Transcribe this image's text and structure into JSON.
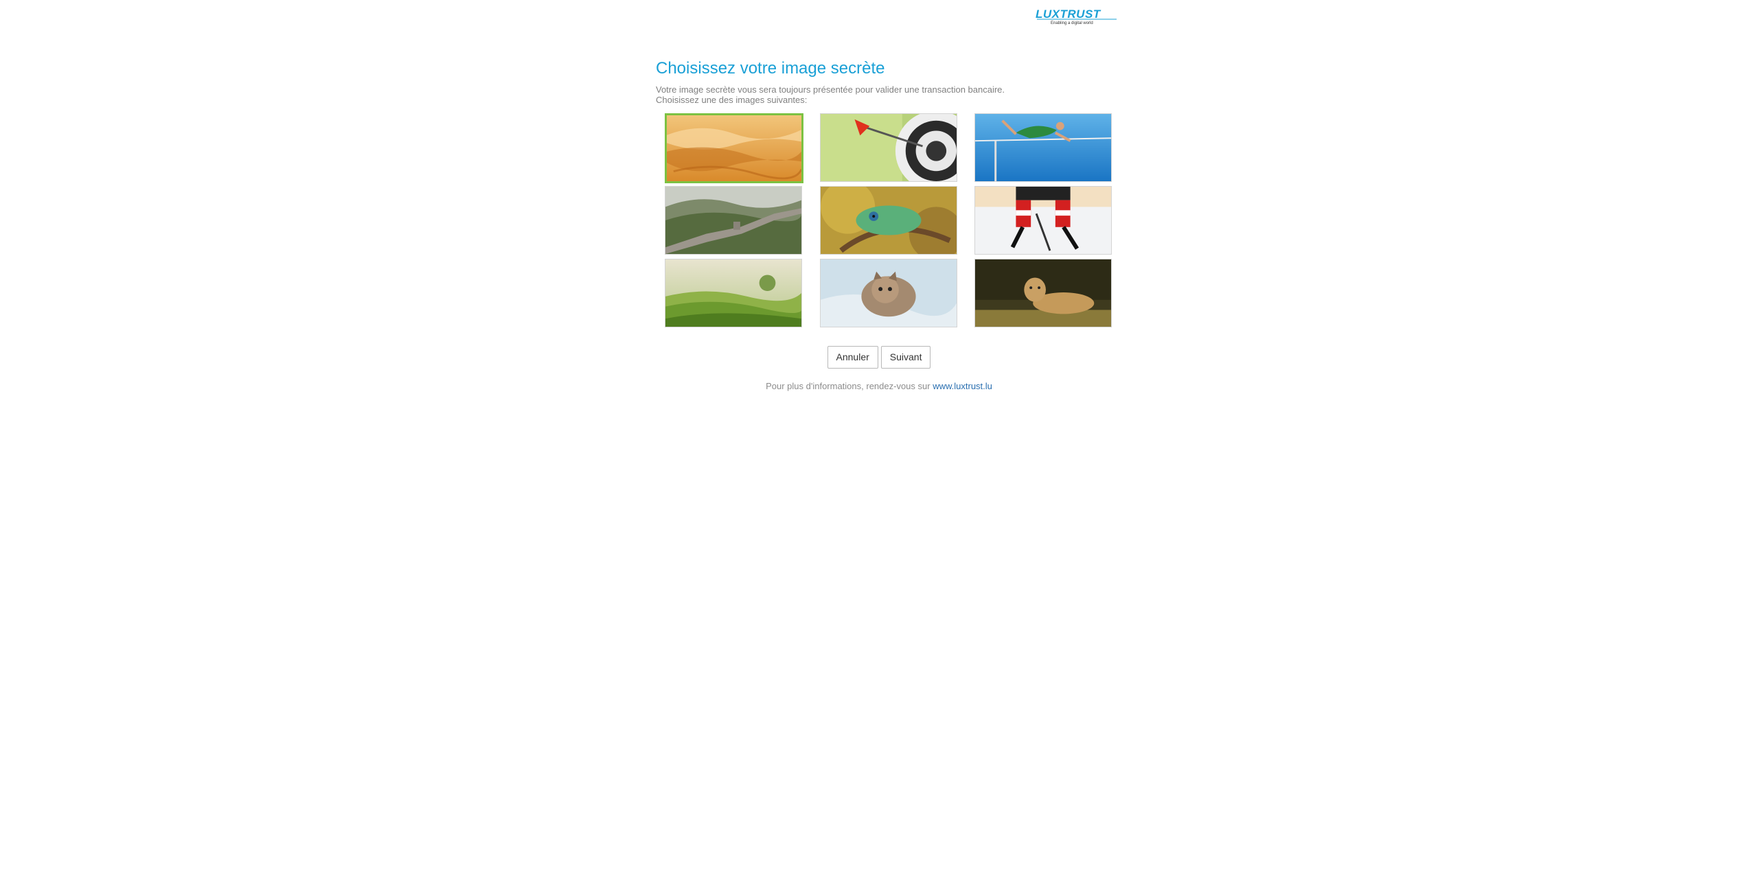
{
  "brand": {
    "logo_text": "LUXTRUST",
    "tagline": "Enabling a digital world",
    "color": "#1aa0d6"
  },
  "main": {
    "title": "Choisissez votre image secrète",
    "description_line1": "Votre image secrète vous sera toujours présentée pour valider une transaction bancaire.",
    "description_line2": "Choisissez une des images suivantes:"
  },
  "images": [
    {
      "subject": "desert-dunes",
      "selected": true
    },
    {
      "subject": "dart-bullseye",
      "selected": false
    },
    {
      "subject": "high-jump-athlete",
      "selected": false
    },
    {
      "subject": "great-wall",
      "selected": false
    },
    {
      "subject": "chameleon",
      "selected": false
    },
    {
      "subject": "ice-hockey",
      "selected": false
    },
    {
      "subject": "tea-plantation",
      "selected": false
    },
    {
      "subject": "kitten",
      "selected": false
    },
    {
      "subject": "lioness",
      "selected": false
    }
  ],
  "actions": {
    "cancel_label": "Annuler",
    "next_label": "Suivant"
  },
  "footer": {
    "text": "Pour plus d'informations, rendez-vous sur",
    "link_text": "www.luxtrust.lu"
  },
  "colors": {
    "title": "#1aa0d6",
    "selected_border": "#7cc242",
    "link": "#2a6fb0"
  }
}
